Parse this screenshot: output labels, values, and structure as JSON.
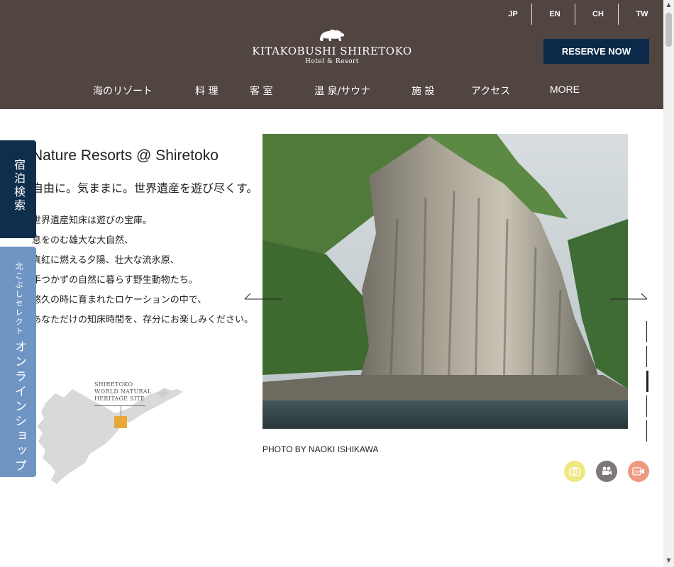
{
  "header": {
    "languages": [
      "JP",
      "EN",
      "CH",
      "TW"
    ],
    "logo": {
      "main": "Kitakobushi Shiretoko",
      "sub": "Hotel & Resort"
    },
    "reserve_label": "RESERVE NOW",
    "nav": [
      "海のリゾート",
      "料 理",
      "客 室",
      "温 泉/サウナ",
      "施 設",
      "アクセス",
      "MORE"
    ]
  },
  "side_tabs": {
    "search": "宿泊検索",
    "shop_small": "北こぶしセレクト",
    "shop_big": "オンラインショップ"
  },
  "intro": {
    "title": "Nature Resorts @ Shiretoko",
    "subtitle": "自由に。気ままに。世界遺産を遊び尽くす。",
    "lines": [
      "世界遺産知床は遊びの宝庫。",
      "息をのむ雄大な大自然、",
      "真紅に燃える夕陽、壮大な流氷原、",
      "手つかずの自然に暮らす野生動物たち。",
      "悠久の時に育まれたロケーションの中で、",
      "あなただけの知床時間を、存分にお楽しみください。"
    ]
  },
  "map": {
    "label_lines": [
      "SHIRETOKO",
      "WORLD NATURAL",
      "HERITAGE SITE"
    ]
  },
  "slider": {
    "credit": "PHOTO BY NAOKI ISHIKAWA",
    "slide_count": 5,
    "active_index": 2
  },
  "media_buttons": [
    {
      "name": "photo-gallery-icon",
      "color": "#eee87f"
    },
    {
      "name": "video-camera-icon",
      "color": "#7d7876"
    },
    {
      "name": "live-camera-icon",
      "color": "#ee9a80"
    }
  ],
  "colors": {
    "header_bg": "#504541",
    "reserve_bg": "#0b2a4a",
    "search_tab_bg": "#0f2e4c",
    "shop_tab_bg": "#6f95c5",
    "map_highlight": "#e7a83a"
  }
}
